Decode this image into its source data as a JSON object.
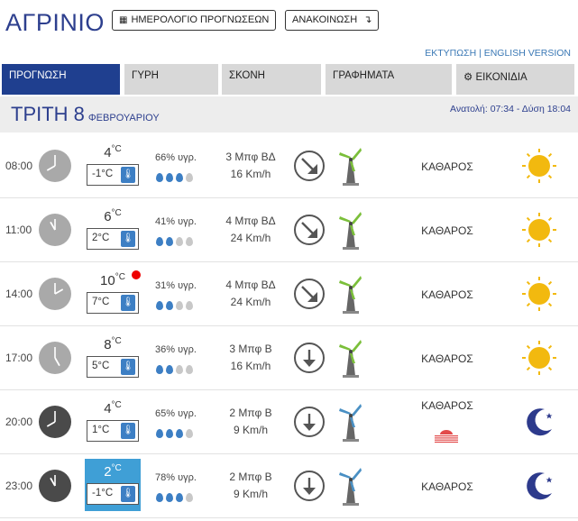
{
  "header": {
    "city": "ΑΓΡΙΝΙΟ",
    "calendar_button": "ΗΜΕΡΟΛΟΓΙΟ ΠΡΟΓΝΩΣΕΩΝ",
    "announcement_button": "ΑΝΑΚΟΙΝΩΣΗ",
    "links": {
      "print": "ΕΚΤΥΠΩΣΗ",
      "separator": " | ",
      "english": "ENGLISH VERSION"
    }
  },
  "tabs": [
    {
      "label": "ΠΡΟΓΝΩΣΗ",
      "active": true
    },
    {
      "label": "ΓΥΡΗ",
      "active": false
    },
    {
      "label": "ΣΚΟΝΗ",
      "active": false
    },
    {
      "label": "ΓΡΑΦΗΜΑΤΑ",
      "active": false
    },
    {
      "label": "ΕΙΚΟΝΙΔΙΑ",
      "active": false,
      "icon": "gear-icon"
    }
  ],
  "day": {
    "name": "ΤΡΙΤΗ 8",
    "month": "ΦΕΒΡΟΥΑΡΙΟΥ",
    "sun": "Ανατολή: 07:34 - Δύση 18:04"
  },
  "rows": [
    {
      "time": "08:00",
      "hour": 8,
      "temp": "4",
      "feels": "-1°C",
      "humidity": "66% υγρ.",
      "drops": 3,
      "wind": "3 Μπφ ΒΔ",
      "speed": "16 Km/h",
      "dir": "ne-to-sw",
      "cond": "ΚΑΘΑΡΟΣ",
      "icon": "sun-icon",
      "night": false,
      "highlight": false,
      "alert": false
    },
    {
      "time": "11:00",
      "hour": 11,
      "temp": "6",
      "feels": "2°C",
      "humidity": "41% υγρ.",
      "drops": 2,
      "wind": "4 Μπφ ΒΔ",
      "speed": "24 Km/h",
      "dir": "ne-to-sw",
      "cond": "ΚΑΘΑΡΟΣ",
      "icon": "sun-icon",
      "night": false,
      "highlight": false,
      "alert": false
    },
    {
      "time": "14:00",
      "hour": 14,
      "temp": "10",
      "feels": "7°C",
      "humidity": "31% υγρ.",
      "drops": 2,
      "wind": "4 Μπφ ΒΔ",
      "speed": "24 Km/h",
      "dir": "ne-to-sw",
      "cond": "ΚΑΘΑΡΟΣ",
      "icon": "sun-icon",
      "night": false,
      "highlight": false,
      "alert": true
    },
    {
      "time": "17:00",
      "hour": 17,
      "temp": "8",
      "feels": "5°C",
      "humidity": "36% υγρ.",
      "drops": 2,
      "wind": "3 Μπφ Β",
      "speed": "16 Km/h",
      "dir": "down",
      "cond": "ΚΑΘΑΡΟΣ",
      "icon": "sun-icon",
      "night": false,
      "highlight": false,
      "alert": false
    },
    {
      "time": "20:00",
      "hour": 20,
      "temp": "4",
      "feels": "1°C",
      "humidity": "65% υγρ.",
      "drops": 3,
      "wind": "2 Μπφ Β",
      "speed": "9 Km/h",
      "dir": "down",
      "cond": "ΚΑΘΑΡΟΣ",
      "icon": "moon-icon",
      "night": true,
      "highlight": false,
      "alert": false,
      "haze": true
    },
    {
      "time": "23:00",
      "hour": 23,
      "temp": "2",
      "feels": "-1°C",
      "humidity": "78% υγρ.",
      "drops": 3,
      "wind": "2 Μπφ Β",
      "speed": "9 Km/h",
      "dir": "down",
      "cond": "ΚΑΘΑΡΟΣ",
      "icon": "moon-icon",
      "night": true,
      "highlight": true,
      "alert": false
    }
  ],
  "colors": {
    "accent": "#1f3f8f",
    "title": "#2d3f8e",
    "sun": "#f2b90f",
    "moon": "#2d3a8c",
    "turbine_day": "#7bbf3a",
    "turbine_night": "#4a90c4",
    "highlight": "#3f9fd6"
  }
}
